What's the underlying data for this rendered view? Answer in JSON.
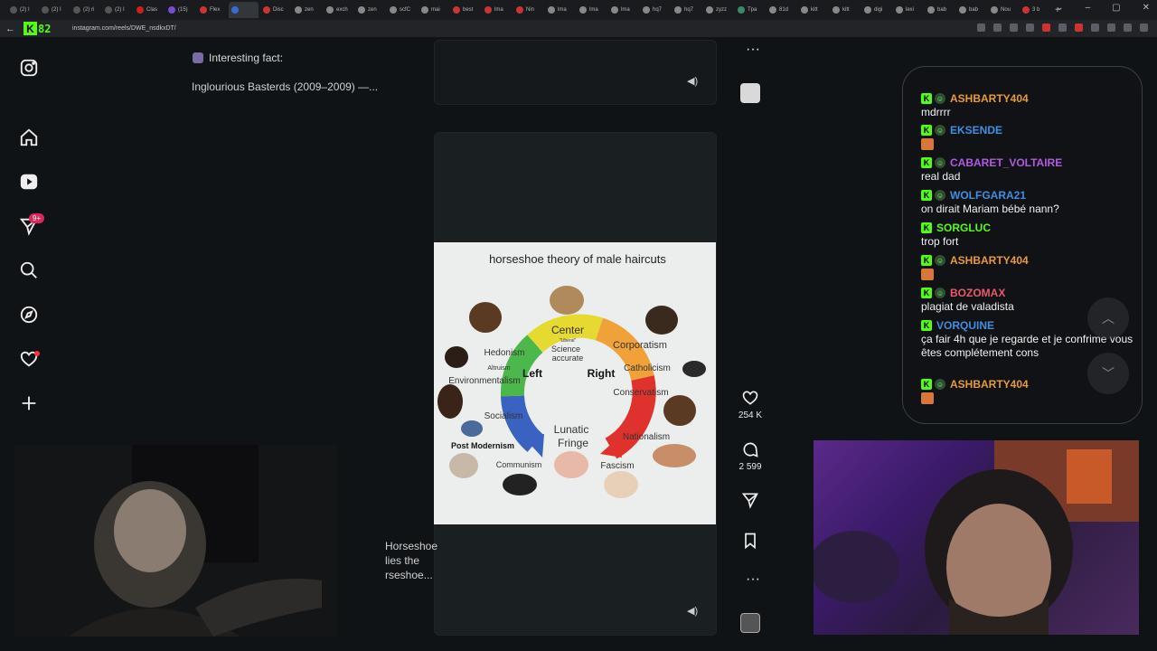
{
  "browser": {
    "tabs": [
      "(2) I",
      "(2) I",
      "(2) ri",
      "(2) I",
      "Clas",
      "(15)",
      "Flex",
      "",
      "Disc",
      "zen",
      "exch",
      "zen",
      "scfC",
      "mai",
      "best",
      "lma",
      "Nin",
      "lma",
      "lma",
      "lma",
      "hq7",
      "hq7",
      "zyzz",
      "Tpa",
      "81d",
      "kitt",
      "kitt",
      "digi",
      "lexi",
      "bab",
      "bab",
      "Nou",
      "3 b"
    ],
    "active_tab_index": 7,
    "url": "instagram.com/reels/DWE_nsdkxDT/",
    "logo_k": "K",
    "logo_num": "82"
  },
  "instagram": {
    "fact_title": "Interesting fact:",
    "fact_body": "Inglourious Basterds (2009–2009) —...",
    "notif_badge": "9+",
    "likes": "254 K",
    "comments": "2 599",
    "caption_lines": [
      "Horseshoe",
      "lies the",
      "rseshoe..."
    ]
  },
  "chart_image": {
    "title": "horseshoe theory of male haircuts",
    "labels": {
      "center": "Center",
      "liberal": "\"Liberal\"",
      "science": "Science",
      "accurate": "accurate",
      "left": "Left",
      "right": "Right",
      "hedonism": "Hedonism",
      "altruism": "Altruism",
      "environmentalism": "Environmentalism",
      "socialism": "Socialism",
      "post_modernism": "Post Modernism",
      "communism": "Communism",
      "lunatic": "Lunatic",
      "fringe": "Fringe",
      "fascism": "Fascism",
      "nationalism": "Nationalism",
      "conservatism": "Conservatism",
      "catholicism": "Catholicism",
      "corporatism": "Corporatism"
    }
  },
  "chat": {
    "messages": [
      {
        "user": "ASHBARTY404",
        "color": "#e89a3a",
        "text": "mdrrrr",
        "emote": false
      },
      {
        "user": "EKSENDE",
        "color": "#3d8fe0",
        "text": "",
        "emote": true
      },
      {
        "user": "CABARET_VOLTAIRE",
        "color": "#b05be0",
        "text": "real dad",
        "emote": false
      },
      {
        "user": "WOLFGARA21",
        "color": "#3d8fe0",
        "text": "on dirait Mariam bébé nann?",
        "emote": false
      },
      {
        "user": "SORGLUC",
        "color": "#53fc18",
        "text": "trop fort",
        "emote": false
      },
      {
        "user": "ASHBARTY404",
        "color": "#e89a3a",
        "text": "",
        "emote": true
      },
      {
        "user": "BOZOMAX",
        "color": "#e85a6a",
        "text": "plagiat de valadista",
        "emote": false
      },
      {
        "user": "VORQUINE",
        "color": "#3d8fe0",
        "text": "ça fair 4h que je regarde et je confrime vous êtes complétement cons",
        "emote": false
      },
      {
        "user": "ASHBARTY404",
        "color": "#e89a3a",
        "text": "",
        "emote": true
      }
    ]
  },
  "colors": {
    "accent_green": "#53fc18",
    "notification_red": "#e0245e"
  },
  "icons": {
    "sidebar": [
      "instagram-icon",
      "home-icon",
      "reels-icon",
      "messages-icon",
      "search-icon",
      "explore-icon",
      "notifications-icon",
      "create-icon"
    ]
  }
}
